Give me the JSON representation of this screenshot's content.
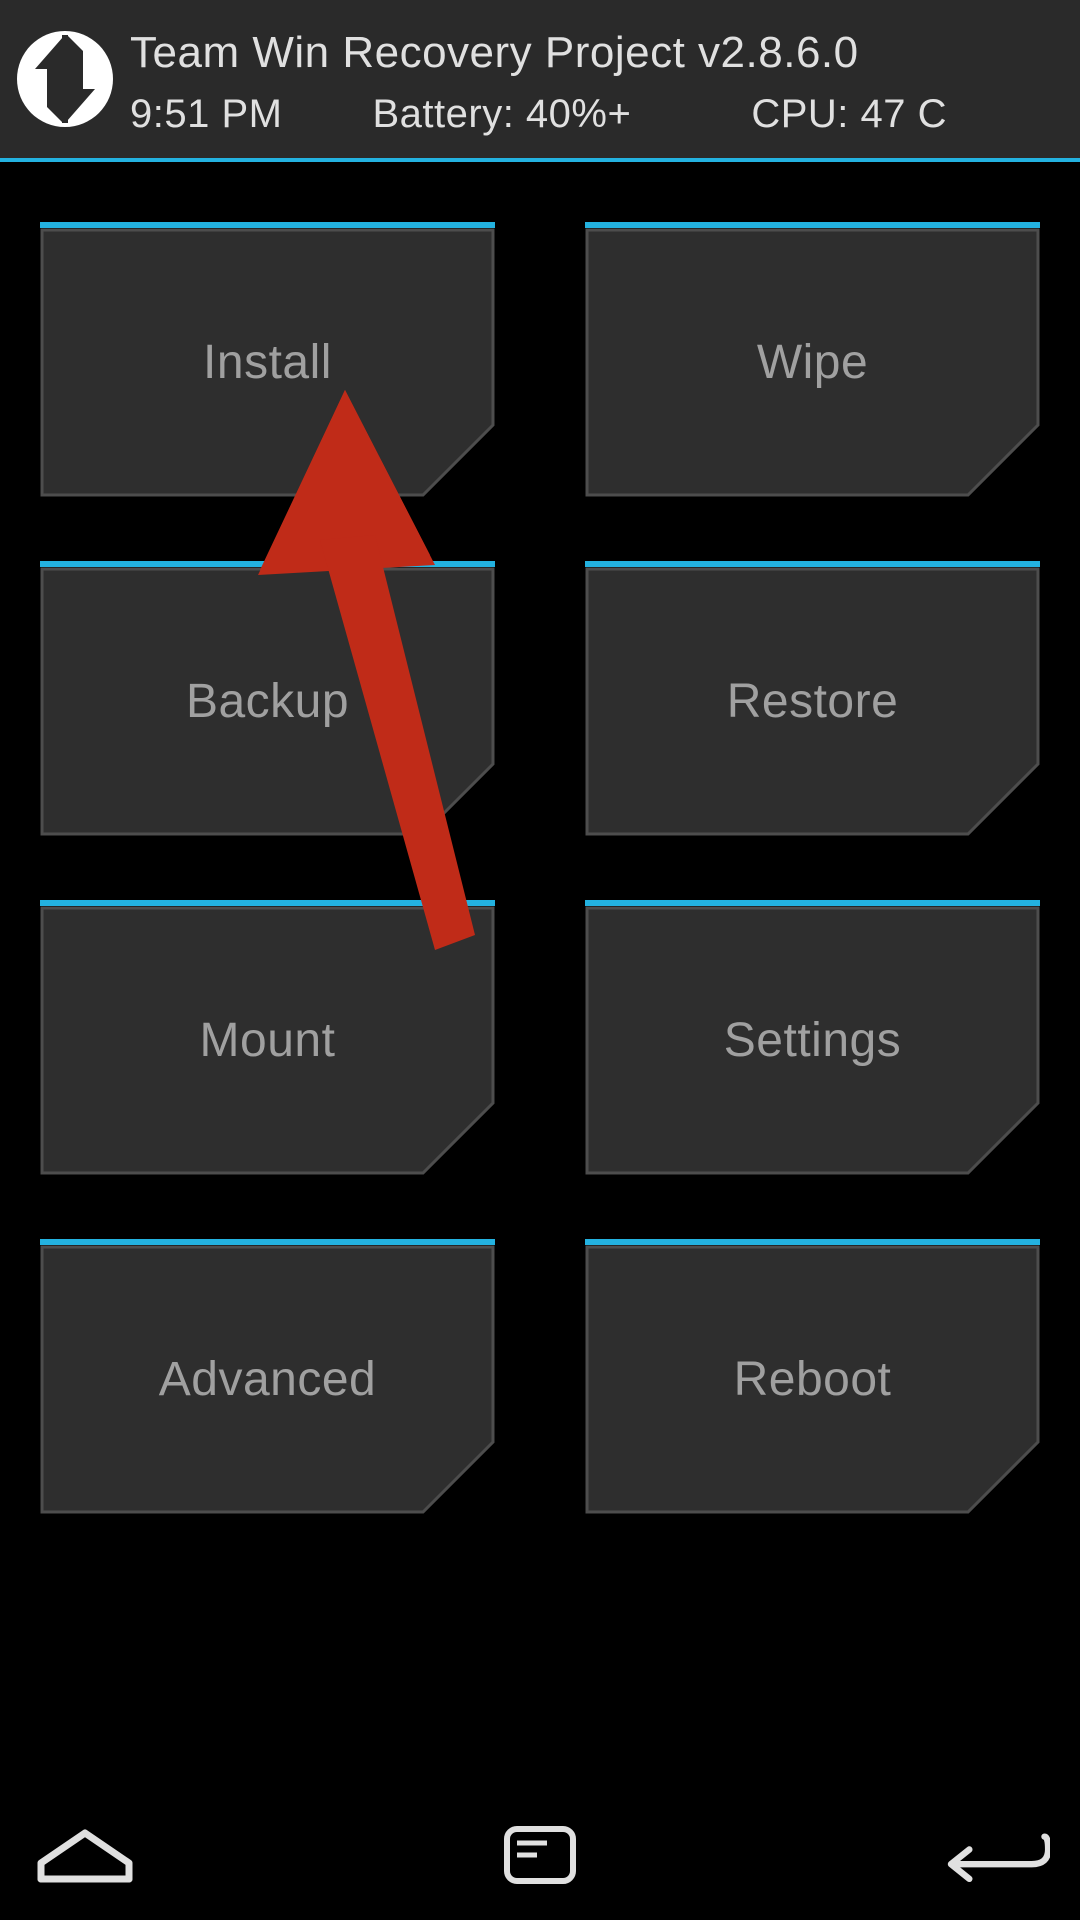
{
  "header": {
    "title": "Team Win Recovery Project  v2.8.6.0",
    "time": "9:51 PM",
    "battery": "Battery: 40%+",
    "cpu": "CPU: 47 C"
  },
  "buttons": {
    "install": "Install",
    "wipe": "Wipe",
    "backup": "Backup",
    "restore": "Restore",
    "mount": "Mount",
    "settings": "Settings",
    "advanced": "Advanced",
    "reboot": "Reboot"
  },
  "colors": {
    "accent": "#23b2e0",
    "tile_fill": "#2e2e2e",
    "tile_stroke": "#4d4d4d",
    "annotation": "#c02b18"
  },
  "nav": {
    "home": "home",
    "console": "console",
    "back": "back"
  },
  "annotation": {
    "target": "install-button"
  }
}
